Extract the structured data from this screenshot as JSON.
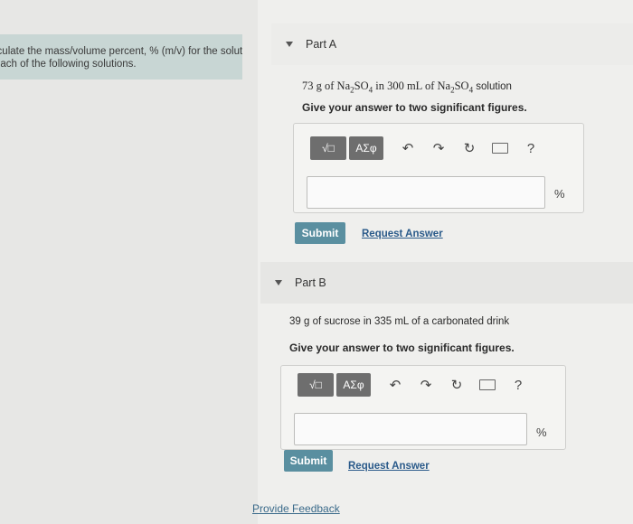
{
  "instructions": {
    "line1": "lculate the mass/volume percent, % (m/v) for the solute",
    "line2": "each of the following solutions."
  },
  "part_a": {
    "title": "Part A",
    "question_prefix": "73 g of Na",
    "question_mid": " in 300 mL of Na",
    "question_suffix": " solution",
    "instruction": "Give your answer to two significant figures.",
    "unit": "%",
    "submit_label": "Submit",
    "request_label": "Request Answer"
  },
  "part_b": {
    "title": "Part B",
    "question": "39 g of sucrose in 335 mL of a carbonated drink",
    "instruction": "Give your answer to two significant figures.",
    "unit": "%",
    "submit_label": "Submit",
    "request_label": "Request Answer"
  },
  "toolbar": {
    "template_label": "√□",
    "greek_label": "ΑΣφ",
    "help_label": "?"
  },
  "feedback_label": "Provide Feedback",
  "colors": {
    "submit": "#5a8fa0",
    "instruction_bg": "#c8d6d4"
  }
}
